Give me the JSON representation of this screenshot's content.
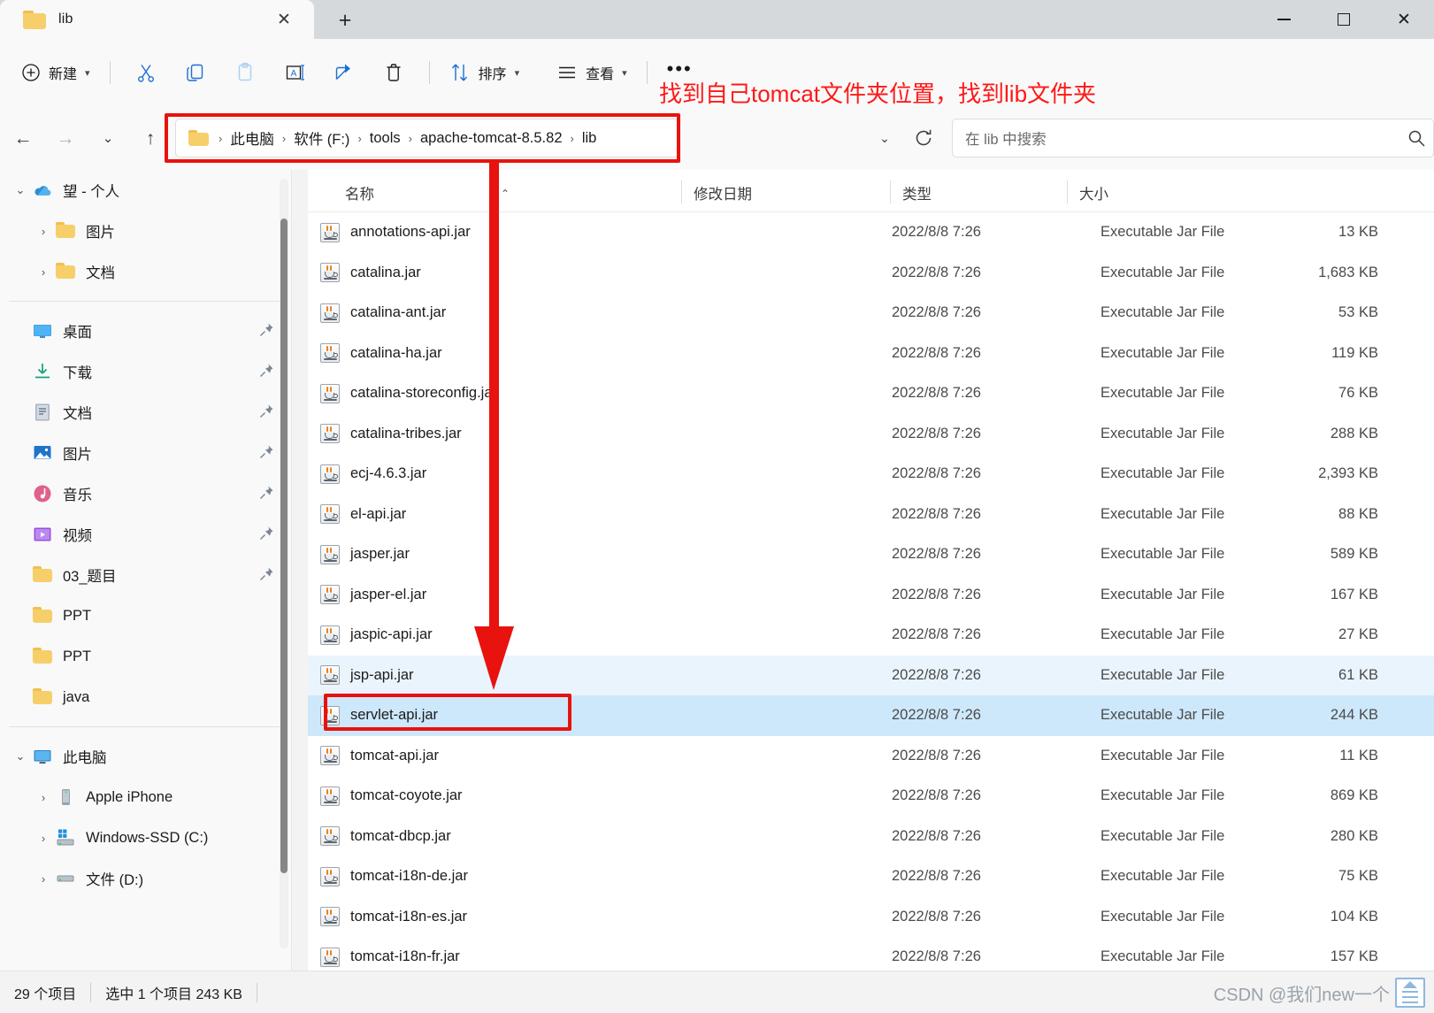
{
  "window": {
    "tab_title": "lib",
    "tab_close_label": "✕",
    "new_tab_label": "+",
    "minimize_label": "minimize",
    "maximize_label": "maximize",
    "close_label": "✕"
  },
  "toolbar": {
    "new_label": "新建",
    "sort_label": "排序",
    "view_label": "查看",
    "more_label": "•••",
    "cut_label": "剪切",
    "copy_label": "复制",
    "paste_label": "粘贴",
    "rename_label": "重命名",
    "share_label": "共享",
    "delete_label": "删除"
  },
  "address": {
    "back_label": "←",
    "forward_label": "→",
    "recent_label": "⌄",
    "up_label": "↑",
    "crumbs": [
      "此电脑",
      "软件 (F:)",
      "tools",
      "apache-tomcat-8.5.82",
      "lib"
    ],
    "separator": "›",
    "dropdown_label": "⌄",
    "refresh_label": "refresh"
  },
  "search": {
    "placeholder": "在 lib 中搜索"
  },
  "sidebar": {
    "onedrive": {
      "label": "望 - 个人",
      "twisty": "⌄"
    },
    "onedrive_children": [
      {
        "label": "图片",
        "twisty": "›"
      },
      {
        "label": "文档",
        "twisty": "›"
      }
    ],
    "quick_access": [
      {
        "label": "桌面",
        "icon": "desktop-icon",
        "pinned": true
      },
      {
        "label": "下载",
        "icon": "download-icon",
        "pinned": true
      },
      {
        "label": "文档",
        "icon": "documents-icon",
        "pinned": true
      },
      {
        "label": "图片",
        "icon": "pictures-icon",
        "pinned": true
      },
      {
        "label": "音乐",
        "icon": "music-icon",
        "pinned": true
      },
      {
        "label": "视频",
        "icon": "video-icon",
        "pinned": true
      },
      {
        "label": "03_题目",
        "icon": "folder-icon",
        "pinned": true
      },
      {
        "label": "PPT",
        "icon": "folder-icon",
        "pinned": false
      },
      {
        "label": "PPT",
        "icon": "folder-icon",
        "pinned": false
      },
      {
        "label": "java",
        "icon": "folder-icon",
        "pinned": false
      }
    ],
    "this_pc": {
      "label": "此电脑",
      "twisty": "⌄"
    },
    "this_pc_children": [
      {
        "label": "Apple iPhone",
        "twisty": "›",
        "icon": "phone-icon"
      },
      {
        "label": "Windows-SSD (C:)",
        "twisty": "›",
        "icon": "windows-drive-icon"
      },
      {
        "label": "文件 (D:)",
        "twisty": "›",
        "icon": "drive-icon"
      }
    ]
  },
  "filelist": {
    "columns": [
      "名称",
      "修改日期",
      "类型",
      "大小"
    ],
    "sort_indicator": "⌃",
    "rows": [
      {
        "name": "annotations-api.jar",
        "date": "2022/8/8 7:26",
        "type": "Executable Jar File",
        "size": "13 KB",
        "state": "normal"
      },
      {
        "name": "catalina.jar",
        "date": "2022/8/8 7:26",
        "type": "Executable Jar File",
        "size": "1,683 KB",
        "state": "normal"
      },
      {
        "name": "catalina-ant.jar",
        "date": "2022/8/8 7:26",
        "type": "Executable Jar File",
        "size": "53 KB",
        "state": "normal"
      },
      {
        "name": "catalina-ha.jar",
        "date": "2022/8/8 7:26",
        "type": "Executable Jar File",
        "size": "119 KB",
        "state": "normal"
      },
      {
        "name": "catalina-storeconfig.jar",
        "date": "2022/8/8 7:26",
        "type": "Executable Jar File",
        "size": "76 KB",
        "state": "normal"
      },
      {
        "name": "catalina-tribes.jar",
        "date": "2022/8/8 7:26",
        "type": "Executable Jar File",
        "size": "288 KB",
        "state": "normal"
      },
      {
        "name": "ecj-4.6.3.jar",
        "date": "2022/8/8 7:26",
        "type": "Executable Jar File",
        "size": "2,393 KB",
        "state": "normal"
      },
      {
        "name": "el-api.jar",
        "date": "2022/8/8 7:26",
        "type": "Executable Jar File",
        "size": "88 KB",
        "state": "normal"
      },
      {
        "name": "jasper.jar",
        "date": "2022/8/8 7:26",
        "type": "Executable Jar File",
        "size": "589 KB",
        "state": "normal"
      },
      {
        "name": "jasper-el.jar",
        "date": "2022/8/8 7:26",
        "type": "Executable Jar File",
        "size": "167 KB",
        "state": "normal"
      },
      {
        "name": "jaspic-api.jar",
        "date": "2022/8/8 7:26",
        "type": "Executable Jar File",
        "size": "27 KB",
        "state": "normal"
      },
      {
        "name": "jsp-api.jar",
        "date": "2022/8/8 7:26",
        "type": "Executable Jar File",
        "size": "61 KB",
        "state": "hover"
      },
      {
        "name": "servlet-api.jar",
        "date": "2022/8/8 7:26",
        "type": "Executable Jar File",
        "size": "244 KB",
        "state": "selected"
      },
      {
        "name": "tomcat-api.jar",
        "date": "2022/8/8 7:26",
        "type": "Executable Jar File",
        "size": "11 KB",
        "state": "normal"
      },
      {
        "name": "tomcat-coyote.jar",
        "date": "2022/8/8 7:26",
        "type": "Executable Jar File",
        "size": "869 KB",
        "state": "normal"
      },
      {
        "name": "tomcat-dbcp.jar",
        "date": "2022/8/8 7:26",
        "type": "Executable Jar File",
        "size": "280 KB",
        "state": "normal"
      },
      {
        "name": "tomcat-i18n-de.jar",
        "date": "2022/8/8 7:26",
        "type": "Executable Jar File",
        "size": "75 KB",
        "state": "normal"
      },
      {
        "name": "tomcat-i18n-es.jar",
        "date": "2022/8/8 7:26",
        "type": "Executable Jar File",
        "size": "104 KB",
        "state": "normal"
      },
      {
        "name": "tomcat-i18n-fr.jar",
        "date": "2022/8/8 7:26",
        "type": "Executable Jar File",
        "size": "157 KB",
        "state": "normal"
      }
    ]
  },
  "statusbar": {
    "item_count": "29 个项目",
    "selection": "选中 1 个项目  243 KB"
  },
  "annotations": {
    "note_text": "找到自己tomcat文件夹位置，找到lib文件夹",
    "color": "#ff1818"
  },
  "watermark": {
    "text": "CSDN @我们new一个"
  }
}
